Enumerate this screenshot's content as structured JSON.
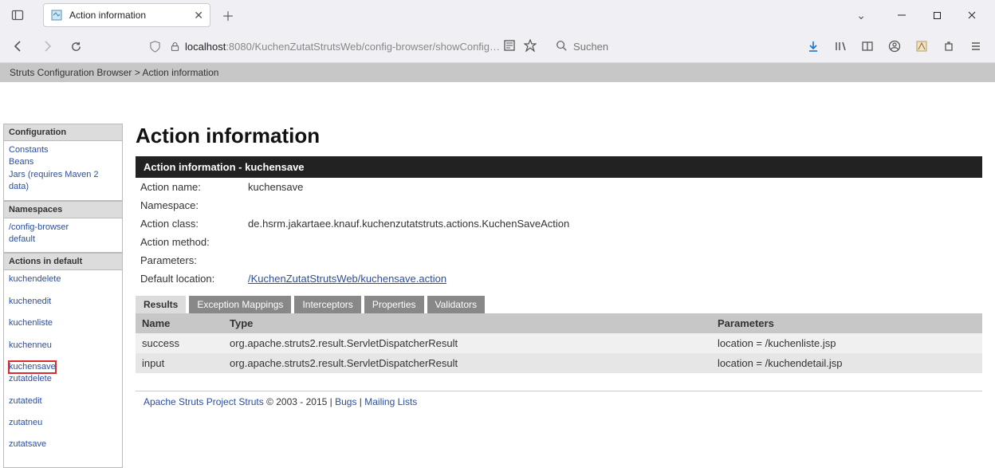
{
  "browser": {
    "tab_title": "Action information",
    "url_host": "localhost",
    "url_port": ":8080",
    "url_path": "/KuchenZutatStrutsWeb/config-browser/showConfig…",
    "search_placeholder": "Suchen"
  },
  "breadcrumb": {
    "root": "Struts Configuration Browser",
    "separator": ">",
    "current": "Action information"
  },
  "sidebar": {
    "configuration": {
      "header": "Configuration",
      "items": [
        "Constants",
        "Beans",
        "Jars (requires Maven 2 data)"
      ]
    },
    "namespaces": {
      "header": "Namespaces",
      "items": [
        "/config-browser",
        "default"
      ]
    },
    "actions": {
      "header": "Actions in default",
      "items": [
        "kuchendelete",
        "kuchenedit",
        "kuchenliste",
        "kuchenneu",
        "kuchensave",
        "zutatdelete",
        "zutatedit",
        "zutatneu",
        "zutatsave"
      ],
      "highlighted": "kuchensave"
    }
  },
  "main": {
    "title": "Action information",
    "action_header": "Action information - kuchensave",
    "rows": {
      "action_name_label": "Action name:",
      "action_name_value": "kuchensave",
      "namespace_label": "Namespace:",
      "namespace_value": "",
      "action_class_label": "Action class:",
      "action_class_value": "de.hsrm.jakartaee.knauf.kuchenzutatstruts.actions.KuchenSaveAction",
      "action_method_label": "Action method:",
      "action_method_value": "",
      "parameters_label": "Parameters:",
      "parameters_value": "",
      "default_location_label": "Default location:",
      "default_location_value": "/KuchenZutatStrutsWeb/kuchensave.action"
    },
    "tabs": [
      "Results",
      "Exception Mappings",
      "Interceptors",
      "Properties",
      "Validators"
    ],
    "active_tab": "Results",
    "results_table": {
      "headers": [
        "Name",
        "Type",
        "Parameters"
      ],
      "rows": [
        {
          "name": "success",
          "type": "org.apache.struts2.result.ServletDispatcherResult",
          "params": "location = /kuchenliste.jsp"
        },
        {
          "name": "input",
          "type": "org.apache.struts2.result.ServletDispatcherResult",
          "params": "location = /kuchendetail.jsp"
        }
      ]
    }
  },
  "footer": {
    "project_link": "Apache Struts Project Struts",
    "copyright": " © 2003 - 2015 | ",
    "bugs": "Bugs",
    "sep": " | ",
    "mailing": "Mailing Lists"
  }
}
